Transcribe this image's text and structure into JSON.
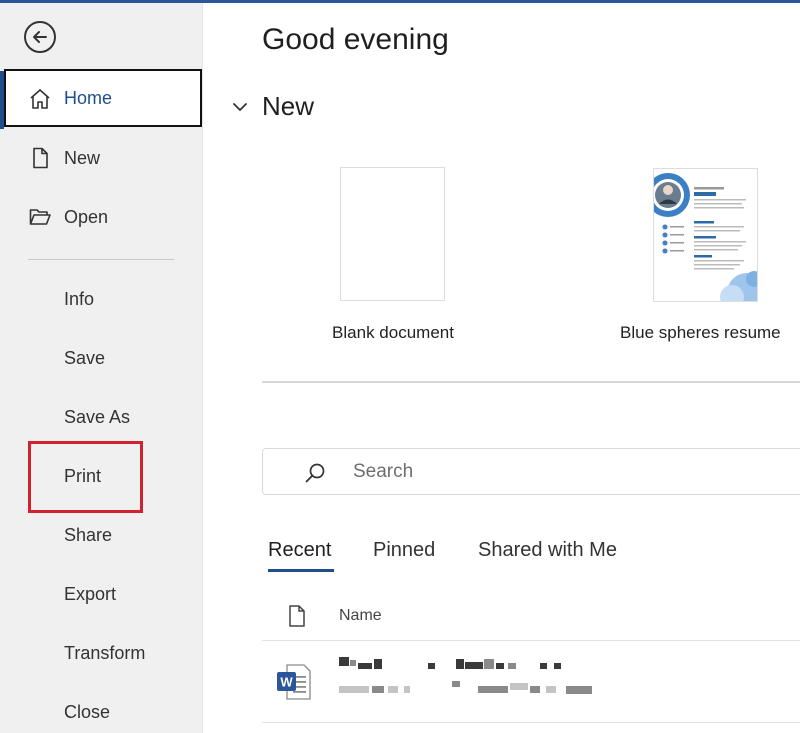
{
  "sidebar": {
    "back_label": "Back",
    "items": [
      {
        "id": "home",
        "label": "Home",
        "icon": "home-icon"
      },
      {
        "id": "new",
        "label": "New",
        "icon": "new-document-icon"
      },
      {
        "id": "open",
        "label": "Open",
        "icon": "folder-open-icon"
      },
      {
        "id": "info",
        "label": "Info"
      },
      {
        "id": "save",
        "label": "Save"
      },
      {
        "id": "save-as",
        "label": "Save As"
      },
      {
        "id": "print",
        "label": "Print"
      },
      {
        "id": "share",
        "label": "Share"
      },
      {
        "id": "export",
        "label": "Export"
      },
      {
        "id": "transform",
        "label": "Transform"
      },
      {
        "id": "close",
        "label": "Close"
      }
    ],
    "active_item": "home",
    "highlighted_item": "print"
  },
  "main": {
    "greeting": "Good evening",
    "new_section": {
      "title": "New",
      "templates": [
        {
          "label": "Blank document"
        },
        {
          "label": "Blue spheres resume"
        }
      ]
    },
    "search": {
      "placeholder": "Search",
      "value": ""
    },
    "tabs": [
      {
        "label": "Recent",
        "active": true
      },
      {
        "label": "Pinned",
        "active": false
      },
      {
        "label": "Shared with Me",
        "active": false
      }
    ],
    "list": {
      "name_header": "Name",
      "files": [
        {
          "name": "",
          "location": "",
          "icon": "word-file-icon",
          "obscured": true
        }
      ]
    }
  },
  "colors": {
    "accent": "#1f4e8a",
    "highlight_border": "#d1222f",
    "sidebar_bg": "#f0f0f0",
    "word_blue": "#2b579a"
  }
}
